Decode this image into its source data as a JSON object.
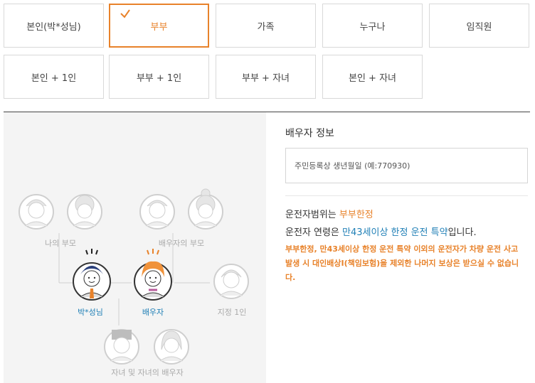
{
  "options_row1": [
    {
      "label": "본인(박*성님)",
      "selected": false
    },
    {
      "label": "부부",
      "selected": true
    },
    {
      "label": "가족",
      "selected": false
    },
    {
      "label": "누구나",
      "selected": false
    },
    {
      "label": "임직원",
      "selected": false
    }
  ],
  "options_row2": [
    {
      "label": "본인 + 1인"
    },
    {
      "label": "부부 + 1인"
    },
    {
      "label": "부부 + 자녀"
    },
    {
      "label": "본인 + 자녀"
    }
  ],
  "diagram": {
    "my_parents": "나의 부모",
    "spouse_parents": "배우자의 부모",
    "me": "박*성님",
    "spouse": "배우자",
    "designated": "지정 1인",
    "children": "자녀 및 자녀의 배우자"
  },
  "spouse_info": {
    "title": "배우자 정보",
    "placeholder": "주민등록상 생년월일 (예:770930)"
  },
  "driver_info": {
    "line1_prefix": "운전자범위는 ",
    "line1_value": "부부한정",
    "line2_prefix": "운전자 연령은 ",
    "line2_value": "만43세이상 한정 운전 특약",
    "line2_suffix": "입니다.",
    "notice": "부부한정, 만43세이상 한정 운전 특약 이외의 운전자가 차량 운전 사고 발생 시 대인배상Ⅰ(책임보험)을 제외한 나머지 보상은 받으실 수 없습니다."
  },
  "colors": {
    "accent_orange": "#e8822a",
    "accent_blue": "#1f7fb6",
    "panel_bg": "#f4f4f4"
  }
}
